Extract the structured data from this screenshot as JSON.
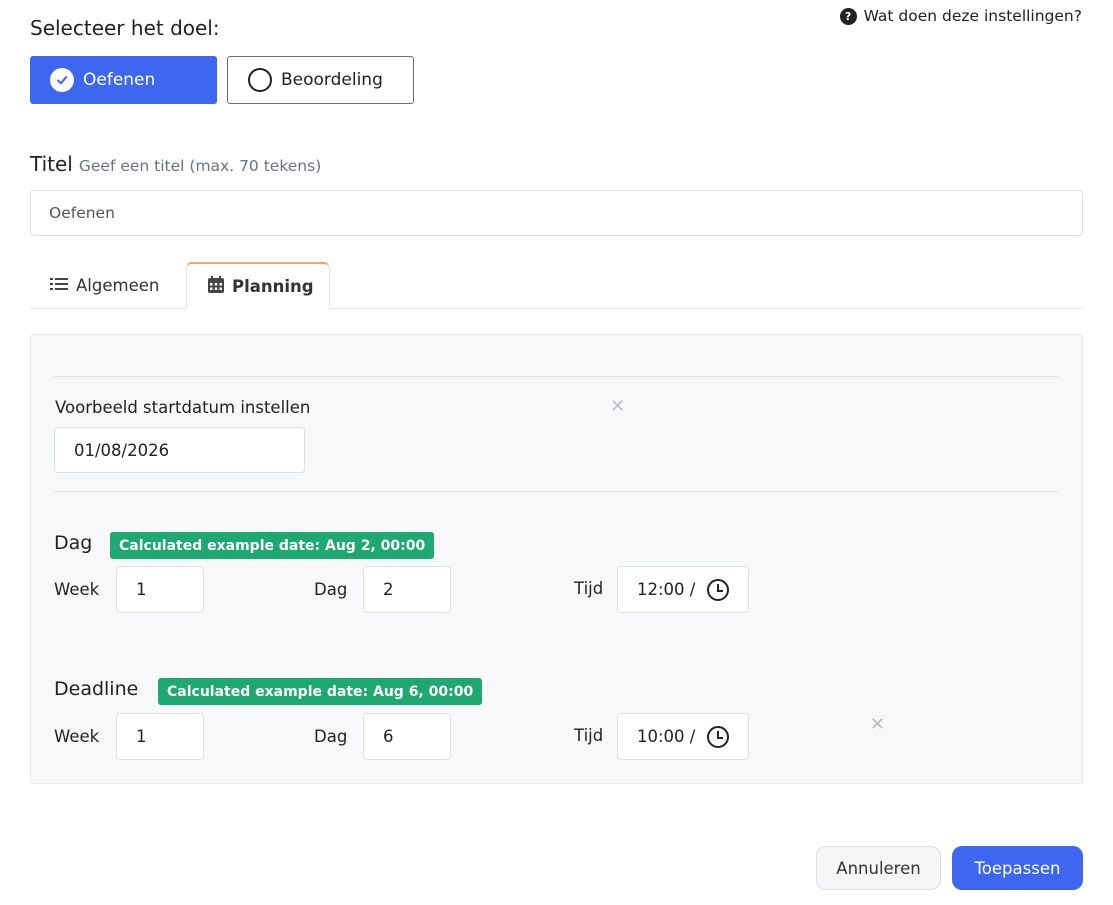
{
  "goal": {
    "label": "Selecteer het doel:",
    "options": [
      {
        "label": "Oefenen",
        "selected": true
      },
      {
        "label": "Beoordeling",
        "selected": false
      }
    ]
  },
  "help": {
    "label": "Wat doen deze instellingen?",
    "icon": "question-circle-icon"
  },
  "title": {
    "label": "Titel",
    "hint": "Geef een titel (max. 70 tekens)",
    "value": "Oefenen"
  },
  "tabs": [
    {
      "label": "Algemeen",
      "icon": "list-icon",
      "active": false
    },
    {
      "label": "Planning",
      "icon": "calendar-icon",
      "active": true
    }
  ],
  "planning": {
    "start_date": {
      "label": "Voorbeeld startdatum instellen",
      "value": "01/08/2026"
    },
    "day": {
      "title": "Dag",
      "badge": "Calculated example date: Aug 2, 00:00",
      "week_label": "Week",
      "week_value": "1",
      "day_label": "Dag",
      "day_value": "2",
      "time_label": "Tijd",
      "time_value": "12:00 /"
    },
    "deadline": {
      "title": "Deadline",
      "badge": "Calculated example date: Aug 6, 00:00",
      "week_label": "Week",
      "week_value": "1",
      "day_label": "Dag",
      "day_value": "6",
      "time_label": "Tijd",
      "time_value": "10:00 /"
    }
  },
  "footer": {
    "cancel_label": "Annuleren",
    "apply_label": "Toepassen"
  },
  "colors": {
    "primary": "#3d67f0",
    "badge": "#1ea872",
    "tab_accent": "#f5a26b"
  }
}
